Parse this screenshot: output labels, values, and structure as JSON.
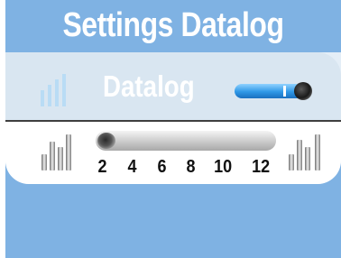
{
  "header": {
    "title": "Settings Datalog"
  },
  "datalog": {
    "label": "Datalog",
    "toggle_state": "on"
  },
  "slider": {
    "ticks": [
      "2",
      "4",
      "6",
      "8",
      "10",
      "12"
    ],
    "value": 2
  },
  "colors": {
    "panel": "#7fb2e3",
    "card": "#d9e6f1",
    "accent": "#2f98e6"
  },
  "icons": {
    "left_signal": "signal-bars-icon",
    "right_signal": "signal-bars-icon",
    "top_signal": "signal-bars-icon"
  }
}
